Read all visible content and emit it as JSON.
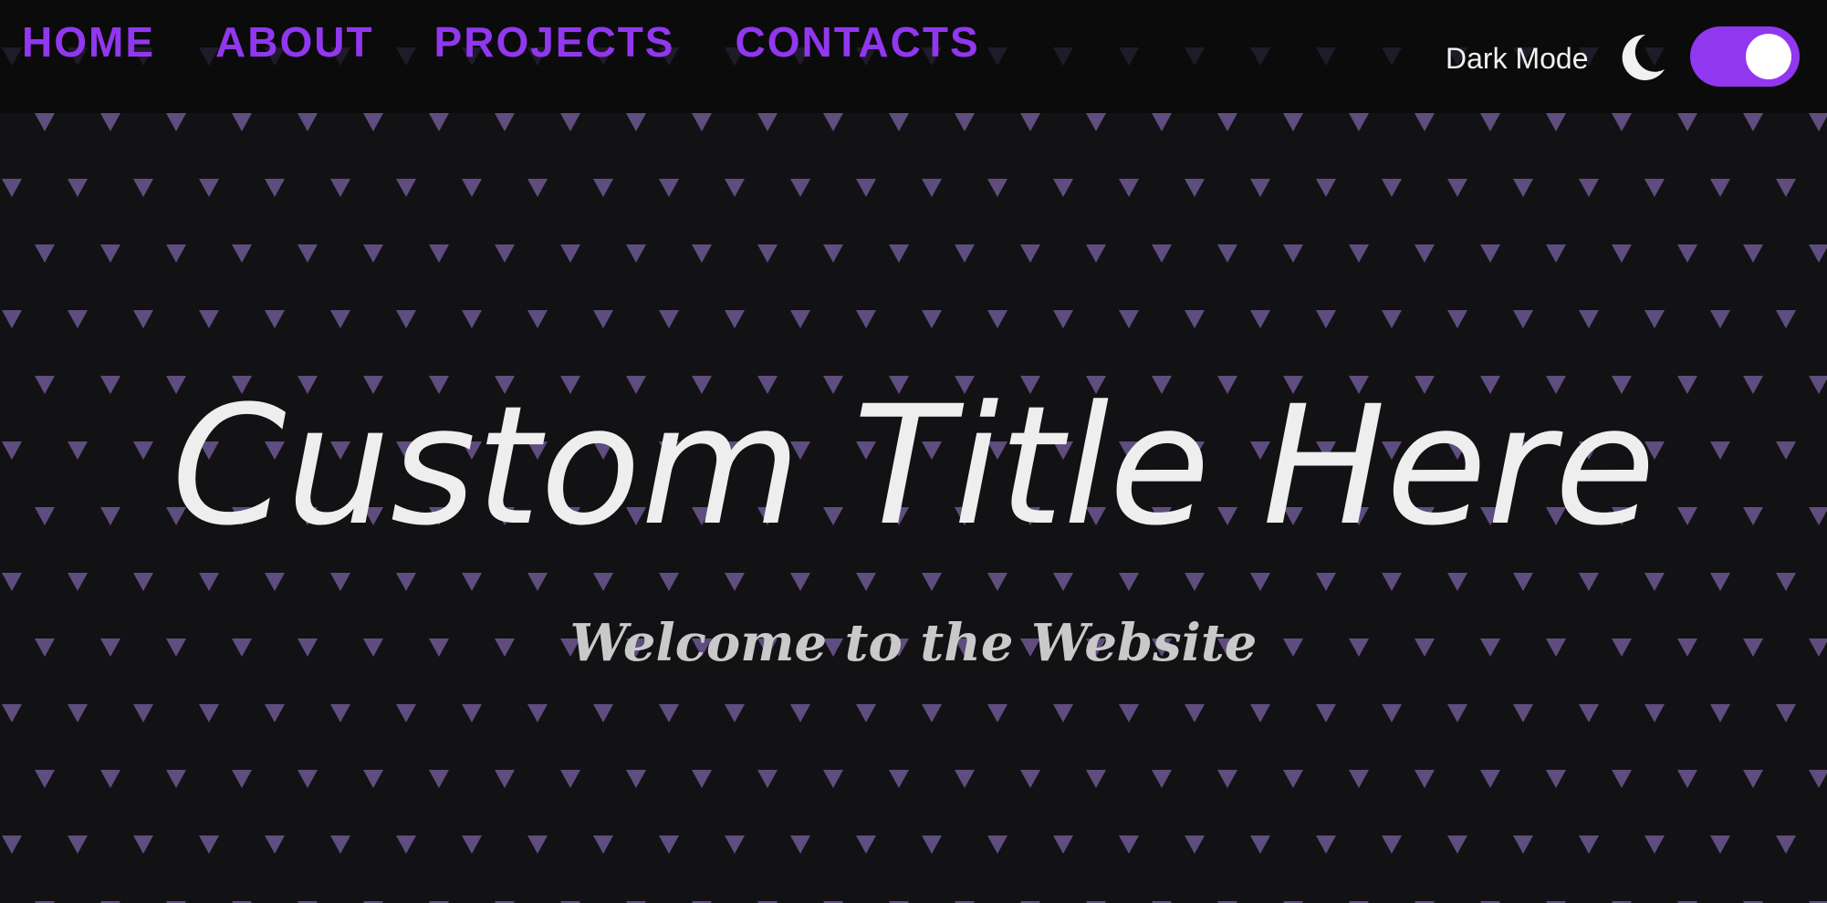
{
  "nav": {
    "links": [
      "HOME",
      "ABOUT",
      "PROJECTS",
      "CONTACTS"
    ]
  },
  "theme_toggle": {
    "label": "Dark Mode",
    "icon": "moon-icon",
    "enabled": true
  },
  "hero": {
    "title": "Custom Title Here",
    "subtitle": "Welcome to the Website"
  },
  "colors": {
    "accent": "#9237f0",
    "background": "#121214",
    "navbar": "#0b0b0c",
    "pattern_triangle": "#5e4d7e",
    "title_text": "#eeeeee",
    "subtitle_text": "#c9c9c9"
  }
}
